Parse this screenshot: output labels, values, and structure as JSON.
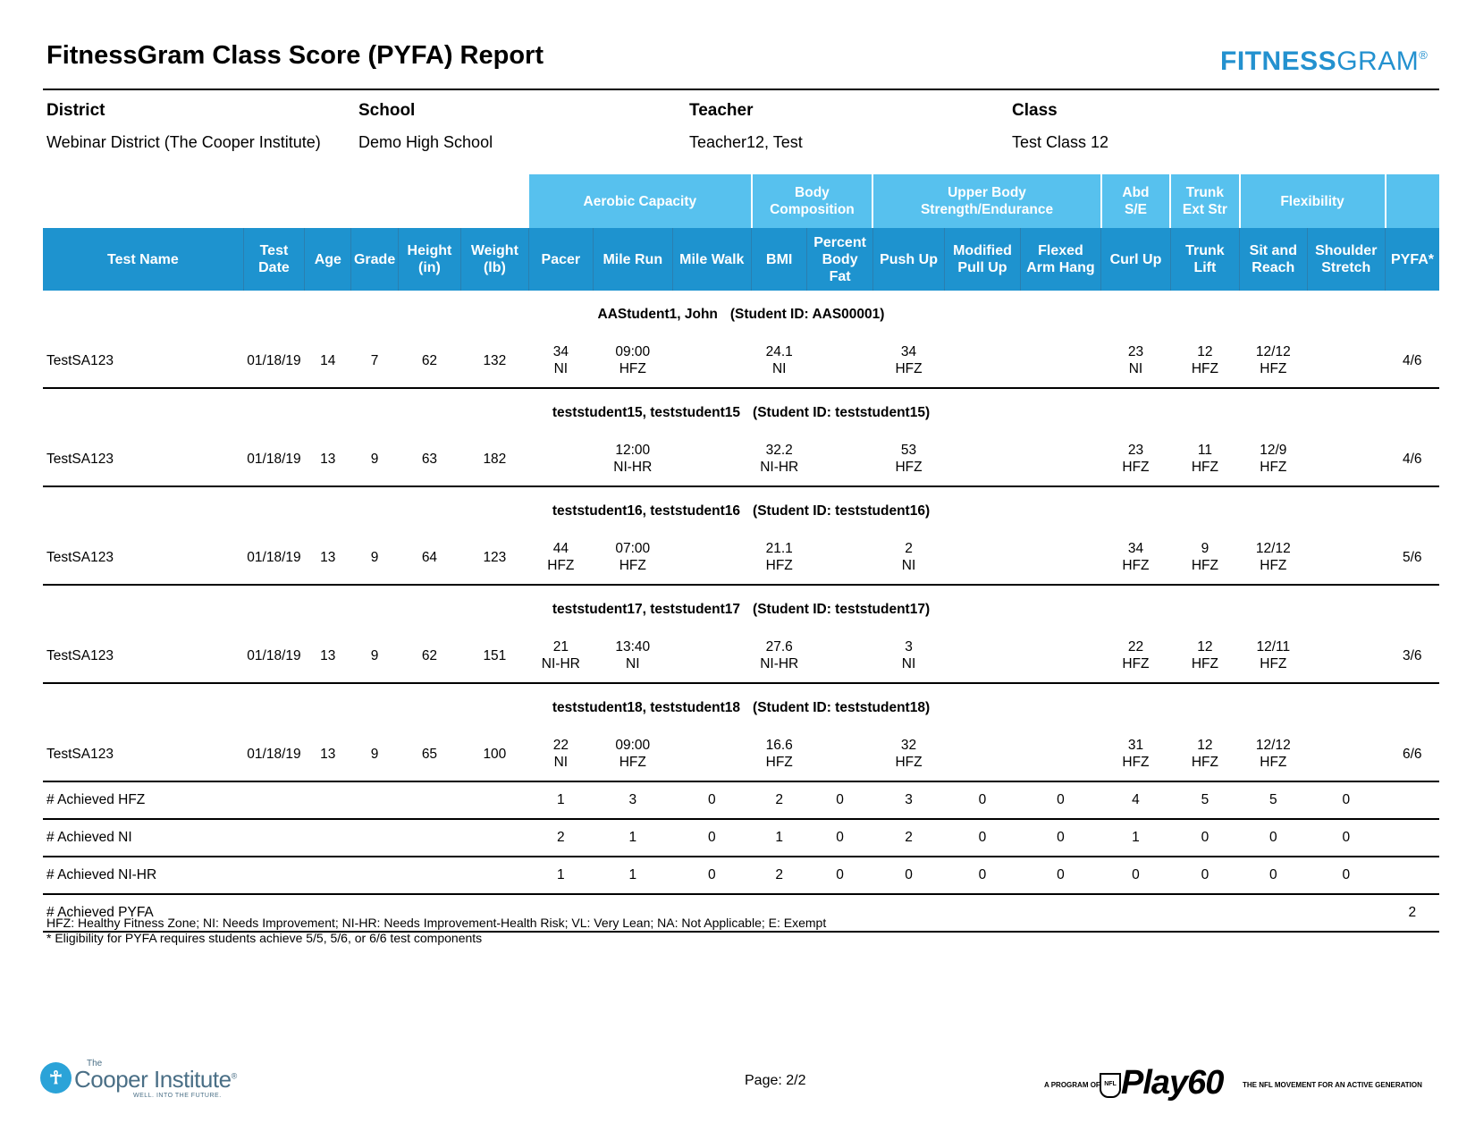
{
  "report": {
    "title": "FitnessGram Class Score (PYFA) Report",
    "brand_part1": "FITNESS",
    "brand_part2": "GRAM",
    "brand_mark": "®"
  },
  "meta": {
    "district_label": "District",
    "district": "Webinar District (The Cooper Institute)",
    "school_label": "School",
    "school": "Demo High School",
    "teacher_label": "Teacher",
    "teacher": "Teacher12, Test",
    "class_label": "Class",
    "class": "Test Class 12"
  },
  "groups": {
    "aerobic": "Aerobic Capacity",
    "body": [
      "Body",
      "Composition"
    ],
    "upper": [
      "Upper Body",
      "Strength/Endurance"
    ],
    "abd": [
      "Abd",
      "S/E"
    ],
    "trunk": [
      "Trunk",
      "Ext Str"
    ],
    "flex": "Flexibility"
  },
  "columns": [
    [
      "Test Name"
    ],
    [
      "Test",
      "Date"
    ],
    [
      "Age"
    ],
    [
      "Grade"
    ],
    [
      "Height",
      "(in)"
    ],
    [
      "Weight",
      "(lb)"
    ],
    [
      "Pacer"
    ],
    [
      "Mile Run"
    ],
    [
      "Mile Walk"
    ],
    [
      "BMI"
    ],
    [
      "Percent",
      "Body",
      "Fat"
    ],
    [
      "Push Up"
    ],
    [
      "Modified",
      "Pull Up"
    ],
    [
      "Flexed",
      "Arm Hang"
    ],
    [
      "Curl Up"
    ],
    [
      "Trunk",
      "Lift"
    ],
    [
      "Sit and",
      "Reach"
    ],
    [
      "Shoulder",
      "Stretch"
    ],
    [
      "PYFA*"
    ]
  ],
  "students": [
    {
      "name": "AAStudent1, John",
      "id": "(Student ID: AAS00001)",
      "cells": [
        [
          "TestSA123"
        ],
        [
          "01/18/19"
        ],
        [
          "14"
        ],
        [
          "7"
        ],
        [
          "62"
        ],
        [
          "132"
        ],
        [
          "34",
          "NI"
        ],
        [
          "09:00",
          "HFZ"
        ],
        [],
        [
          "24.1",
          "NI"
        ],
        [],
        [
          "34",
          "HFZ"
        ],
        [],
        [],
        [
          "23",
          "NI"
        ],
        [
          "12",
          "HFZ"
        ],
        [
          "12/12",
          "HFZ"
        ],
        [],
        [
          "4/6"
        ]
      ]
    },
    {
      "name": "teststudent15, teststudent15",
      "id": "(Student ID: teststudent15)",
      "cells": [
        [
          "TestSA123"
        ],
        [
          "01/18/19"
        ],
        [
          "13"
        ],
        [
          "9"
        ],
        [
          "63"
        ],
        [
          "182"
        ],
        [],
        [
          "12:00",
          "NI-HR"
        ],
        [],
        [
          "32.2",
          "NI-HR"
        ],
        [],
        [
          "53",
          "HFZ"
        ],
        [],
        [],
        [
          "23",
          "HFZ"
        ],
        [
          "11",
          "HFZ"
        ],
        [
          "12/9",
          "HFZ"
        ],
        [],
        [
          "4/6"
        ]
      ]
    },
    {
      "name": "teststudent16, teststudent16",
      "id": "(Student ID: teststudent16)",
      "cells": [
        [
          "TestSA123"
        ],
        [
          "01/18/19"
        ],
        [
          "13"
        ],
        [
          "9"
        ],
        [
          "64"
        ],
        [
          "123"
        ],
        [
          "44",
          "HFZ"
        ],
        [
          "07:00",
          "HFZ"
        ],
        [],
        [
          "21.1",
          "HFZ"
        ],
        [],
        [
          "2",
          "NI"
        ],
        [],
        [],
        [
          "34",
          "HFZ"
        ],
        [
          "9",
          "HFZ"
        ],
        [
          "12/12",
          "HFZ"
        ],
        [],
        [
          "5/6"
        ]
      ]
    },
    {
      "name": "teststudent17, teststudent17",
      "id": "(Student ID: teststudent17)",
      "cells": [
        [
          "TestSA123"
        ],
        [
          "01/18/19"
        ],
        [
          "13"
        ],
        [
          "9"
        ],
        [
          "62"
        ],
        [
          "151"
        ],
        [
          "21",
          "NI-HR"
        ],
        [
          "13:40",
          "NI"
        ],
        [],
        [
          "27.6",
          "NI-HR"
        ],
        [],
        [
          "3",
          "NI"
        ],
        [],
        [],
        [
          "22",
          "HFZ"
        ],
        [
          "12",
          "HFZ"
        ],
        [
          "12/11",
          "HFZ"
        ],
        [],
        [
          "3/6"
        ]
      ]
    },
    {
      "name": "teststudent18, teststudent18",
      "id": "(Student ID: teststudent18)",
      "cells": [
        [
          "TestSA123"
        ],
        [
          "01/18/19"
        ],
        [
          "13"
        ],
        [
          "9"
        ],
        [
          "65"
        ],
        [
          "100"
        ],
        [
          "22",
          "NI"
        ],
        [
          "09:00",
          "HFZ"
        ],
        [],
        [
          "16.6",
          "HFZ"
        ],
        [],
        [
          "32",
          "HFZ"
        ],
        [],
        [],
        [
          "31",
          "HFZ"
        ],
        [
          "12",
          "HFZ"
        ],
        [
          "12/12",
          "HFZ"
        ],
        [],
        [
          "6/6"
        ]
      ]
    }
  ],
  "summary": [
    {
      "label": "# Achieved HFZ",
      "values": [
        "1",
        "3",
        "0",
        "2",
        "0",
        "3",
        "0",
        "0",
        "4",
        "5",
        "5",
        "0",
        ""
      ]
    },
    {
      "label": "# Achieved NI",
      "values": [
        "2",
        "1",
        "0",
        "1",
        "0",
        "2",
        "0",
        "0",
        "1",
        "0",
        "0",
        "0",
        ""
      ]
    },
    {
      "label": "# Achieved NI-HR",
      "values": [
        "1",
        "1",
        "0",
        "2",
        "0",
        "0",
        "0",
        "0",
        "0",
        "0",
        "0",
        "0",
        ""
      ]
    },
    {
      "label": "# Achieved PYFA",
      "values": [
        "",
        "",
        "",
        "",
        "",
        "",
        "",
        "",
        "",
        "",
        "",
        "",
        "2"
      ]
    }
  ],
  "legend": {
    "line1": "HFZ: Healthy Fitness Zone; NI: Needs Improvement; NI-HR: Needs Improvement-Health Risk; VL: Very Lean; NA: Not Applicable; E: Exempt",
    "line2": "* Eligibility for PYFA requires students achieve 5/5, 5/6, or 6/6 test components"
  },
  "footer": {
    "page": "Page: 2/2",
    "cooper_the": "The",
    "cooper_name": "Cooper Institute",
    "cooper_tm": "®",
    "cooper_tag": "WELL. INTO THE FUTURE.",
    "play_pre": "A PROGRAM OF",
    "play_nfl": "NFL",
    "play_word": "Play60",
    "play_post": "THE NFL MOVEMENT FOR AN ACTIVE GENERATION"
  },
  "colors": {
    "header_dark": "#1e93cf",
    "header_light": "#57c1ee",
    "brand": "#2391cf"
  }
}
